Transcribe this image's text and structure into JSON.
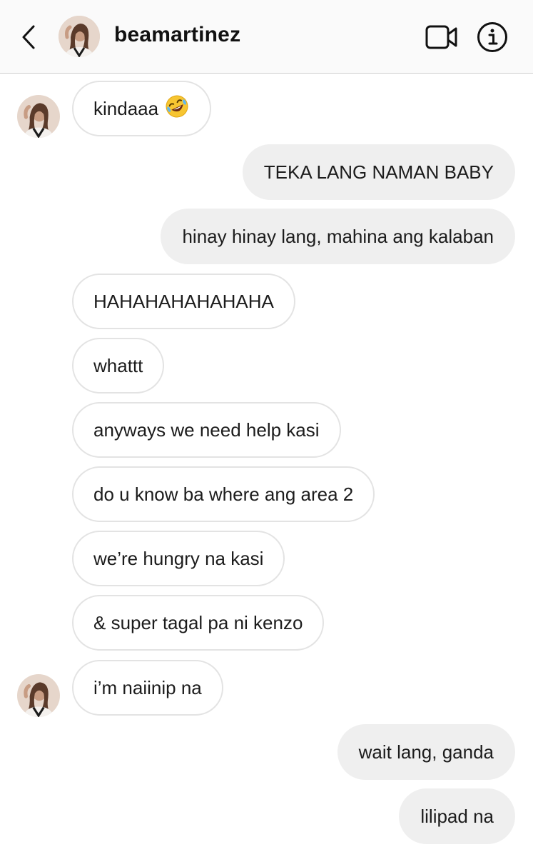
{
  "header": {
    "username": "beamartinez"
  },
  "messages": [
    {
      "text": "kindaaa",
      "emoji": "rolling-on-floor-laughing-emoji"
    },
    {
      "text": "TEKA LANG NAMAN BABY"
    },
    {
      "text": "hinay hinay lang, mahina ang kalaban"
    },
    {
      "text": "HAHAHAHAHAHAHA"
    },
    {
      "text": "whattt"
    },
    {
      "text": "anyways we need help kasi"
    },
    {
      "text": "do u know ba where ang area 2"
    },
    {
      "text": "we’re hungry na kasi"
    },
    {
      "text": "& super tagal pa ni kenzo"
    },
    {
      "text": "i’m naiinip na"
    },
    {
      "text": "wait lang, ganda"
    },
    {
      "text": "lilipad na"
    }
  ],
  "icons": {
    "back": "chevron-left-icon",
    "video": "video-camera-icon",
    "info": "info-circle-icon"
  },
  "colors": {
    "incoming_bubble_border": "#e3e3e3",
    "outgoing_bubble_bg": "#efefef",
    "header_bg": "#fafafa",
    "text": "#1c1c1c"
  }
}
